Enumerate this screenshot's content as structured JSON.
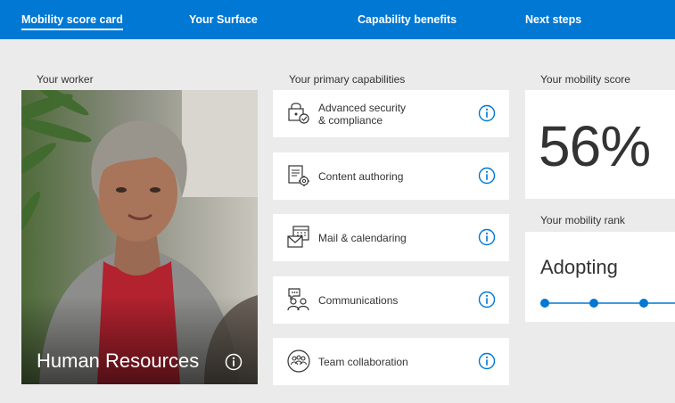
{
  "nav": {
    "items": [
      {
        "label": "Mobility score card",
        "active": true
      },
      {
        "label": "Your Surface",
        "active": false
      },
      {
        "label": "Capability benefits",
        "active": false
      },
      {
        "label": "Next steps",
        "active": false
      }
    ],
    "color": "#0078d4"
  },
  "worker": {
    "section_label": "Your worker",
    "title": "Human Resources",
    "info_icon": "info-circle-icon"
  },
  "capabilities": {
    "section_label": "Your primary capabilities",
    "items": [
      {
        "label_line1": "Advanced security",
        "label_line2": "& compliance",
        "icon": "lock-check-icon"
      },
      {
        "label_line1": "Content authoring",
        "label_line2": "",
        "icon": "document-gear-icon"
      },
      {
        "label_line1": "Mail & calendaring",
        "label_line2": "",
        "icon": "mail-calendar-icon"
      },
      {
        "label_line1": "Communications",
        "label_line2": "",
        "icon": "chat-people-icon"
      },
      {
        "label_line1": "Team collaboration",
        "label_line2": "",
        "icon": "team-circle-icon"
      }
    ],
    "info_color": "#0078d4"
  },
  "score": {
    "section_label": "Your mobility score",
    "value": "56%"
  },
  "rank": {
    "section_label": "Your mobility rank",
    "value": "Adopting",
    "track_color": "#0078d4"
  }
}
